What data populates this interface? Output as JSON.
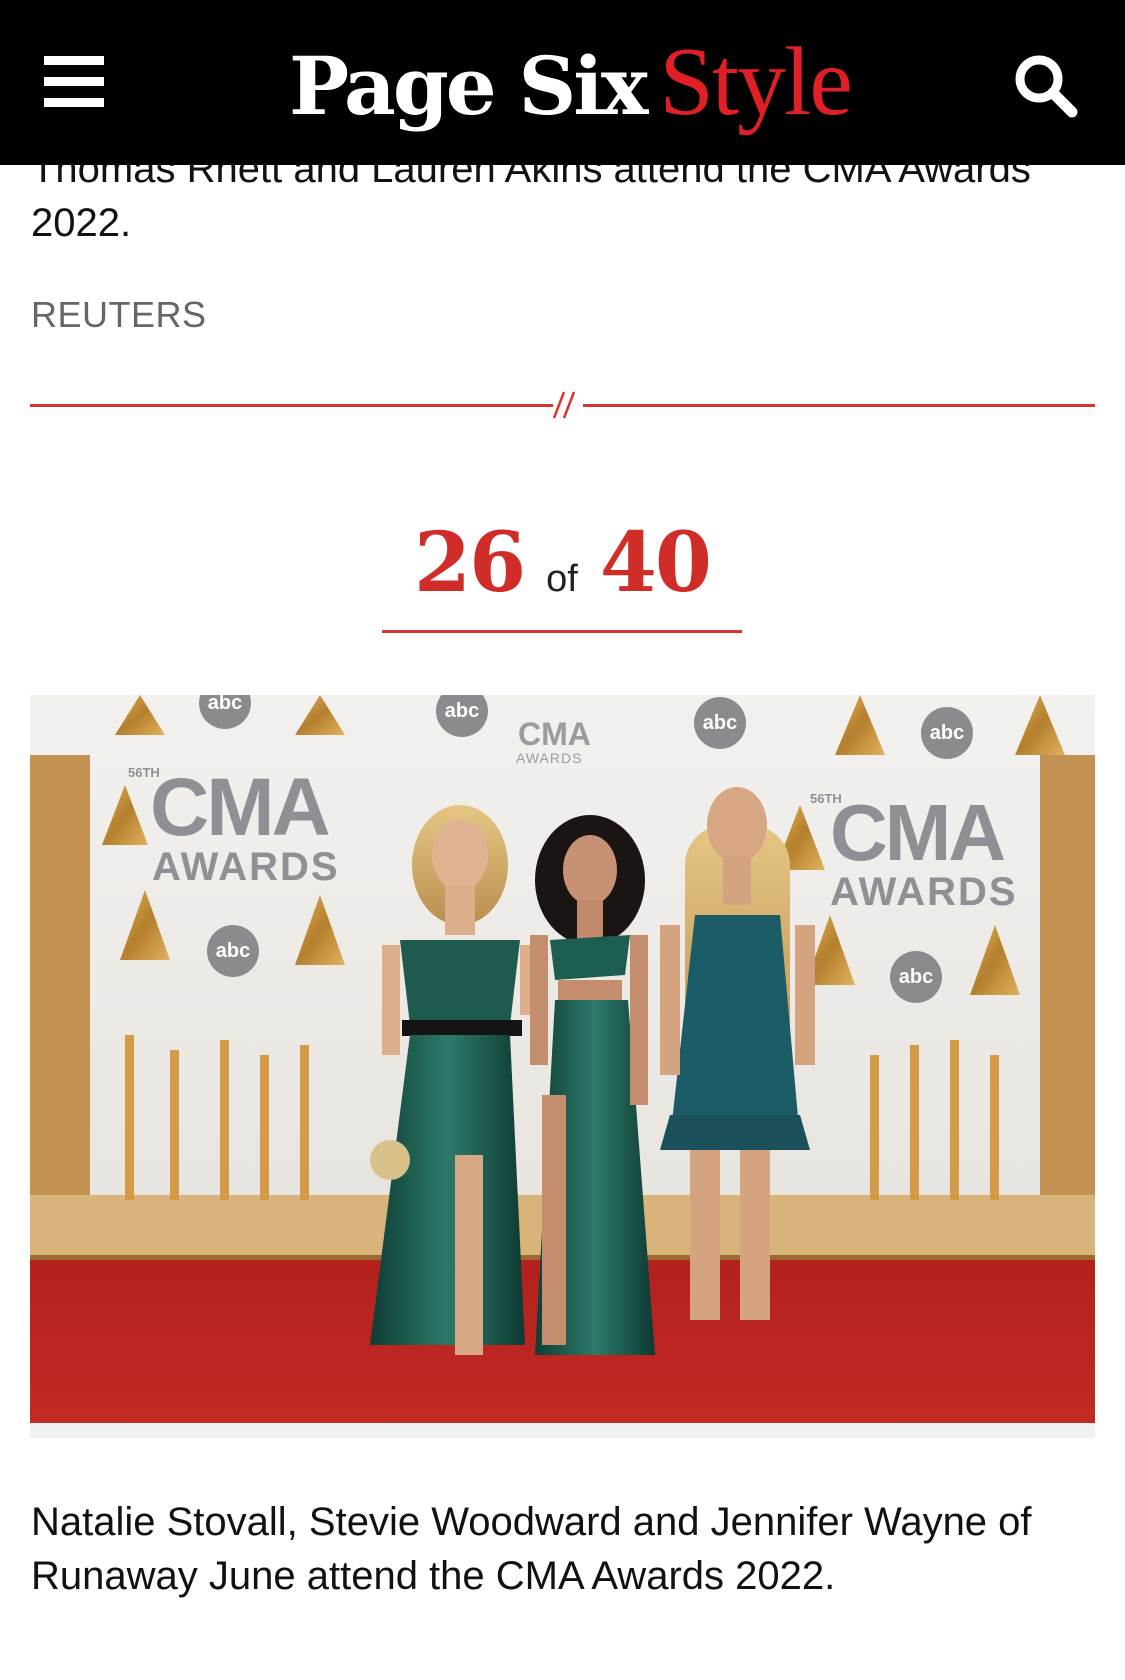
{
  "header": {
    "brand_main": "Page Six",
    "brand_accent": "Style",
    "menu_icon": "hamburger-menu-icon",
    "search_icon": "search-icon",
    "background": "#000000",
    "accent_color": "#e01f26"
  },
  "previous_slide": {
    "caption": "Thomas Rhett and Lauren Akins attend the CMA Awards 2022.",
    "credit": "REUTERS"
  },
  "divider": {
    "color": "#d5372f",
    "icon": "double-slash-icon"
  },
  "counter": {
    "current": "26",
    "separator": "of",
    "total": "40",
    "color": "#d12d28"
  },
  "slide": {
    "caption": "Natalie Stovall, Stevie Woodward and Jennifer Wayne of Runaway June attend the CMA Awards 2022.",
    "photo": {
      "backdrop_logo_text": "CMA",
      "backdrop_logo_subtext": "AWARDS",
      "backdrop_small_badge": "56TH",
      "network_badge": "abc"
    }
  }
}
